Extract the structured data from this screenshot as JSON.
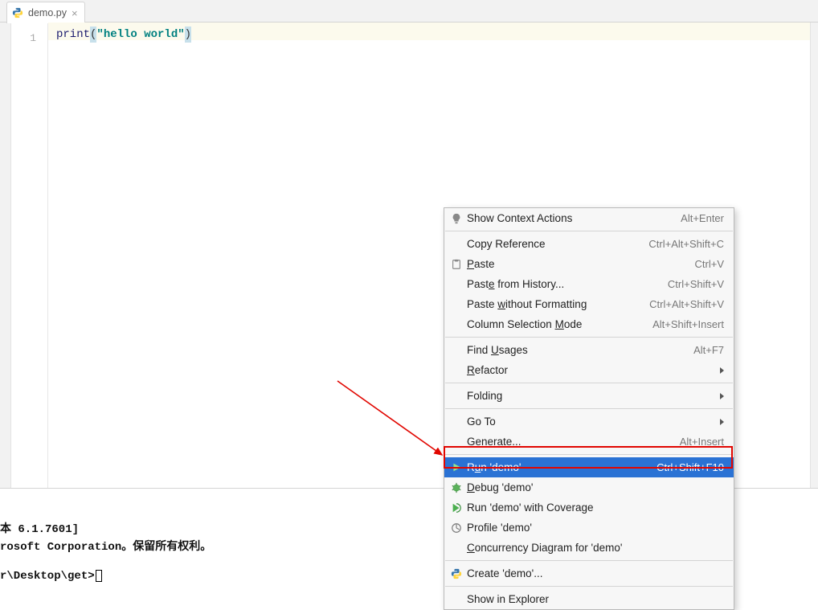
{
  "tab": {
    "filename": "demo.py"
  },
  "editor": {
    "line_number": "1",
    "code": {
      "fn": "print",
      "open": "(",
      "string": "\"hello world\"",
      "close": ")"
    }
  },
  "terminal": {
    "line1": "本 6.1.7601]",
    "line2": "rosoft Corporation。保留所有权利。",
    "prompt": "r\\Desktop\\get>"
  },
  "context_menu": {
    "items": [
      {
        "icon": "bulb",
        "label": "Show Context Actions",
        "shortcut": "Alt+Enter"
      },
      {
        "sep": true
      },
      {
        "label": "Copy Reference",
        "mn": "",
        "shortcut": "Ctrl+Alt+Shift+C"
      },
      {
        "icon": "paste",
        "label_raw": "<u>P</u>aste",
        "plain": "Paste",
        "shortcut": "Ctrl+V"
      },
      {
        "label_raw": "Past<u>e</u> from History...",
        "plain": "Paste from History...",
        "shortcut": "Ctrl+Shift+V"
      },
      {
        "label_raw": "Paste <u>w</u>ithout Formatting",
        "plain": "Paste without Formatting",
        "shortcut": "Ctrl+Alt+Shift+V"
      },
      {
        "label_raw": "Column Selection <u>M</u>ode",
        "plain": "Column Selection Mode",
        "shortcut": "Alt+Shift+Insert"
      },
      {
        "sep": true
      },
      {
        "label_raw": "Find <u>U</u>sages",
        "plain": "Find Usages",
        "shortcut": "Alt+F7"
      },
      {
        "label_raw": "<u>R</u>efactor",
        "plain": "Refactor",
        "submenu": true
      },
      {
        "sep": true
      },
      {
        "label": "Folding",
        "submenu": true
      },
      {
        "sep": true
      },
      {
        "label": "Go To",
        "submenu": true
      },
      {
        "label_raw": "<u>G</u>enerate...",
        "plain": "Generate...",
        "shortcut": "Alt+Insert"
      },
      {
        "sep": true
      },
      {
        "icon": "run-green",
        "label_raw": "R<u>u</u>n 'demo'",
        "plain": "Run 'demo'",
        "shortcut": "Ctrl+Shift+F10",
        "highlighted": true
      },
      {
        "icon": "debug",
        "label_raw": "<u>D</u>ebug 'demo'",
        "plain": "Debug 'demo'"
      },
      {
        "icon": "coverage",
        "label": "Run 'demo' with Coverage"
      },
      {
        "icon": "profile",
        "label": "Profile 'demo'"
      },
      {
        "label_raw": "<u>C</u>oncurrency Diagram for 'demo'",
        "plain": "Concurrency Diagram for 'demo'"
      },
      {
        "sep": true
      },
      {
        "icon": "python",
        "label": "Create 'demo'..."
      },
      {
        "sep": true
      },
      {
        "label": "Show in Explorer"
      }
    ]
  },
  "annotation": {
    "arrow_color": "#e10600"
  }
}
